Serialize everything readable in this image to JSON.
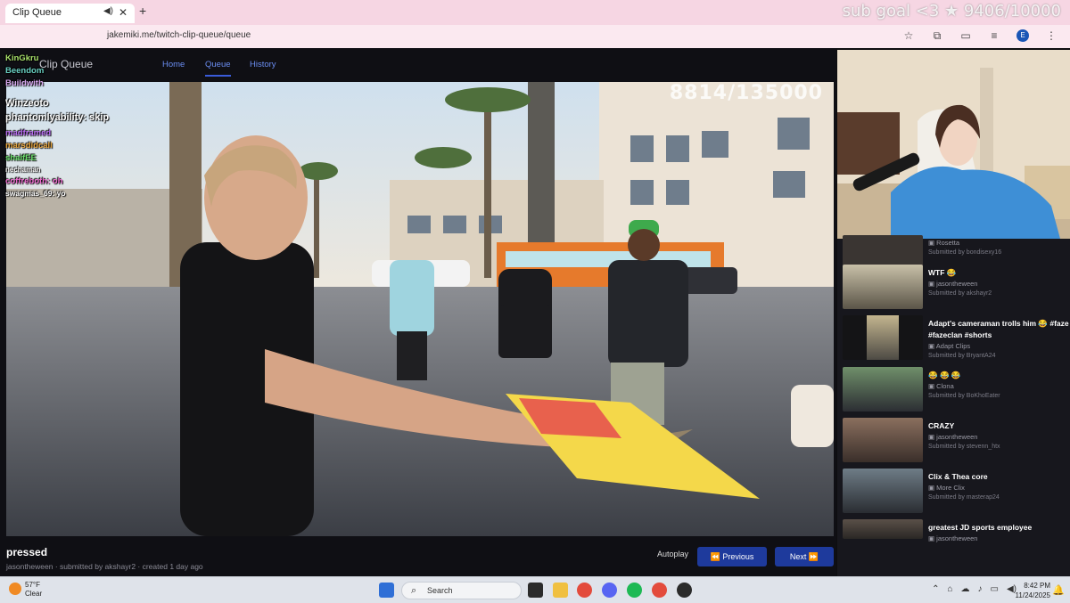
{
  "browser": {
    "tab_title": "Clip Queue",
    "new_tab": "+",
    "url": "jakemiki.me/twitch-clip-queue/queue",
    "overlay_text": "sub goal <3 ★ 9406/10000"
  },
  "app": {
    "logo": "Clip Queue",
    "nav": {
      "home": "Home",
      "queue": "Queue",
      "history": "History"
    }
  },
  "video": {
    "counter_overlay": "8814/135000"
  },
  "current_clip": {
    "title": "pressed",
    "meta": "jasontheween · submitted by akshayr2 · created 1 day ago"
  },
  "controls": {
    "autoplay": "Autoplay",
    "previous": "Previous",
    "next": "Next"
  },
  "chat": [
    {
      "name": "KinGkru",
      "text": ""
    },
    {
      "name": "Beendom",
      "text": ""
    },
    {
      "name": "Buildwith",
      "text": ""
    },
    {
      "name": "Winzeoto",
      "text": ""
    },
    {
      "name": "phantomlyability",
      "text": ": skip"
    },
    {
      "name": "madframed",
      "text": ""
    },
    {
      "name": "marsdidcall",
      "text": ""
    },
    {
      "name": "shaifEE",
      "text": ""
    },
    {
      "name": "nechaman",
      "text": ""
    },
    {
      "name": "coffreboth",
      "text": ": oh"
    },
    {
      "name": "swagmas_69",
      "text": ": yo"
    }
  ],
  "queue": [
    {
      "title": "",
      "channel": "Rosetta",
      "submitted": "Submitted by bondisexy16"
    },
    {
      "title": "WTF 😂",
      "channel": "jasontheween",
      "submitted": "Submitted by akshayr2"
    },
    {
      "title": "Adapt's cameraman trolls him 😂 #faze #fazeclan #shorts",
      "channel": "Adapt Clips",
      "submitted": "Submitted by BryantA24"
    },
    {
      "title": "😂 😂 😂",
      "channel": "Clona",
      "submitted": "Submitted by BoKhoEater"
    },
    {
      "title": "CRAZY",
      "channel": "jasontheween",
      "submitted": "Submitted by stevenn_htx"
    },
    {
      "title": "Clix & Thea core",
      "channel": "More Clix",
      "submitted": "Submitted by masterap24"
    },
    {
      "title": "greatest JD sports employee",
      "channel": "jasontheween",
      "submitted": ""
    }
  ],
  "taskbar": {
    "temp": "57°F",
    "condition": "Clear",
    "search_placeholder": "Search",
    "time": "8:42 PM",
    "date": "11/24/2025"
  }
}
